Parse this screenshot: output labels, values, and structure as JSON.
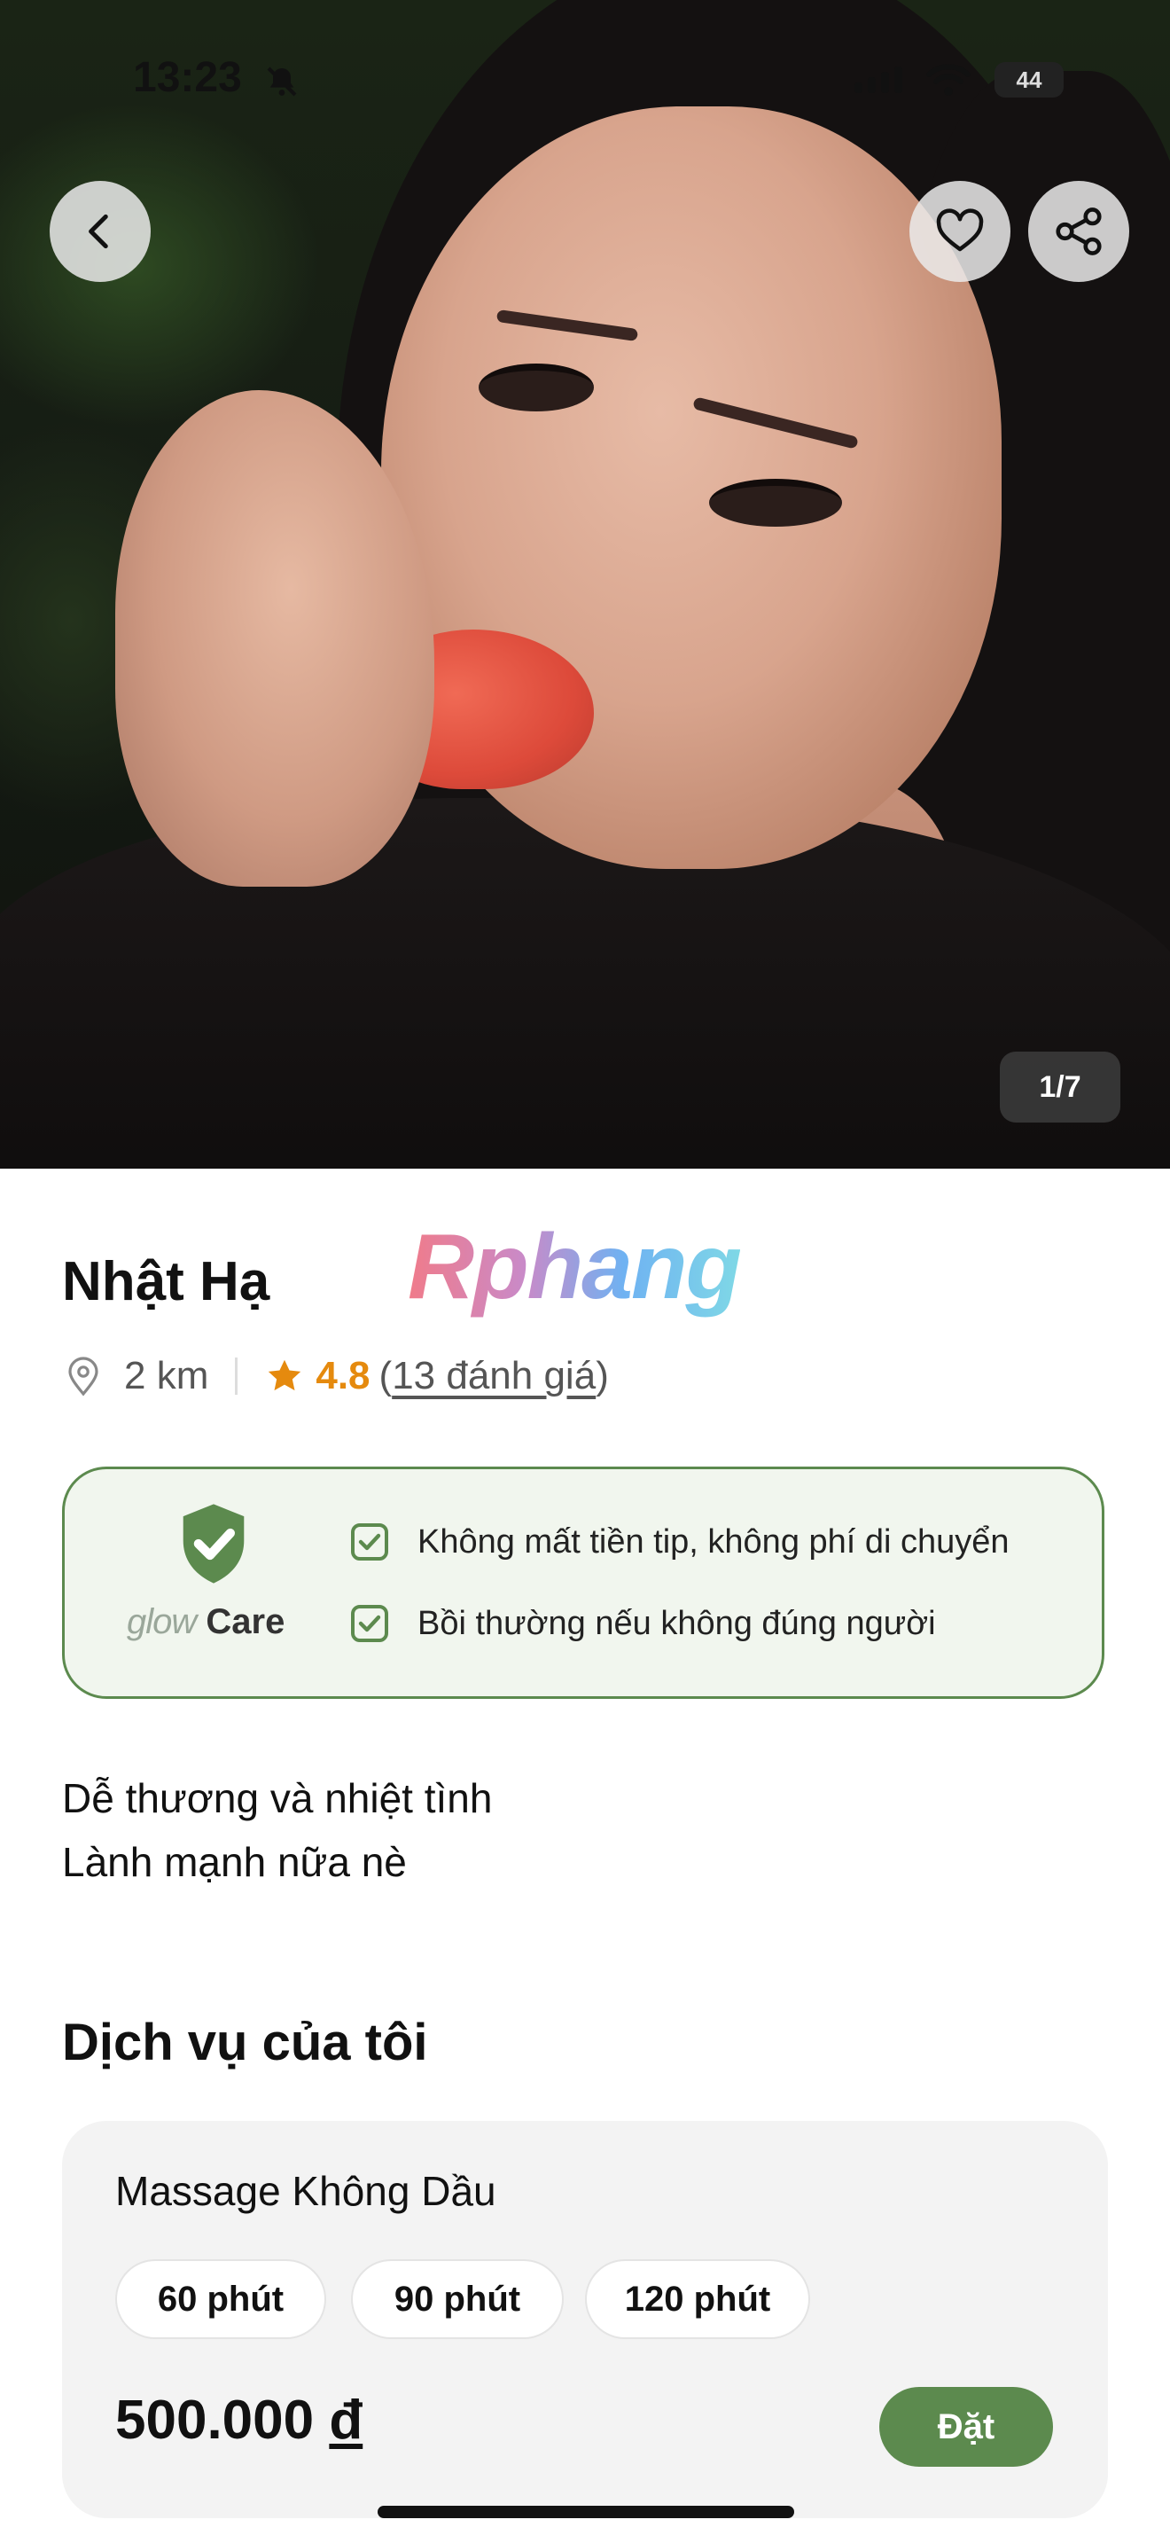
{
  "status_bar": {
    "time": "13:23",
    "battery": "44"
  },
  "gallery": {
    "counter": "1/7"
  },
  "profile": {
    "name": "Nhật Hạ",
    "distance": "2 km",
    "rating": "4.8",
    "reviews_open": "(",
    "reviews_label": "13 đánh giá",
    "reviews_close": ")"
  },
  "watermark": "Rphang",
  "glow_care": {
    "logo_glow": "glow",
    "logo_care": "Care",
    "items": [
      "Không mất tiền tip, không phí di chuyển",
      "Bồi thường nếu không đúng người"
    ]
  },
  "description": [
    "Dễ thương và nhiệt tình",
    "Lành mạnh nữa nè"
  ],
  "services": {
    "title": "Dịch vụ của tôi",
    "items": [
      {
        "name": "Massage Không Dầu",
        "durations": [
          "60 phút",
          "90 phút",
          "120 phút"
        ],
        "price": "500.000",
        "currency": "đ",
        "book_label": "Đặt"
      }
    ]
  },
  "colors": {
    "accent_green": "#5c8a4e",
    "rating_orange": "#e58a0e",
    "care_bg": "#f1f6ee"
  },
  "icons": [
    "back-icon",
    "heart-icon",
    "share-icon",
    "location-pin-icon",
    "star-icon",
    "shield-check-icon",
    "checkbox-icon",
    "bell-slash-icon",
    "signal-icon",
    "wifi-icon",
    "battery-icon"
  ]
}
